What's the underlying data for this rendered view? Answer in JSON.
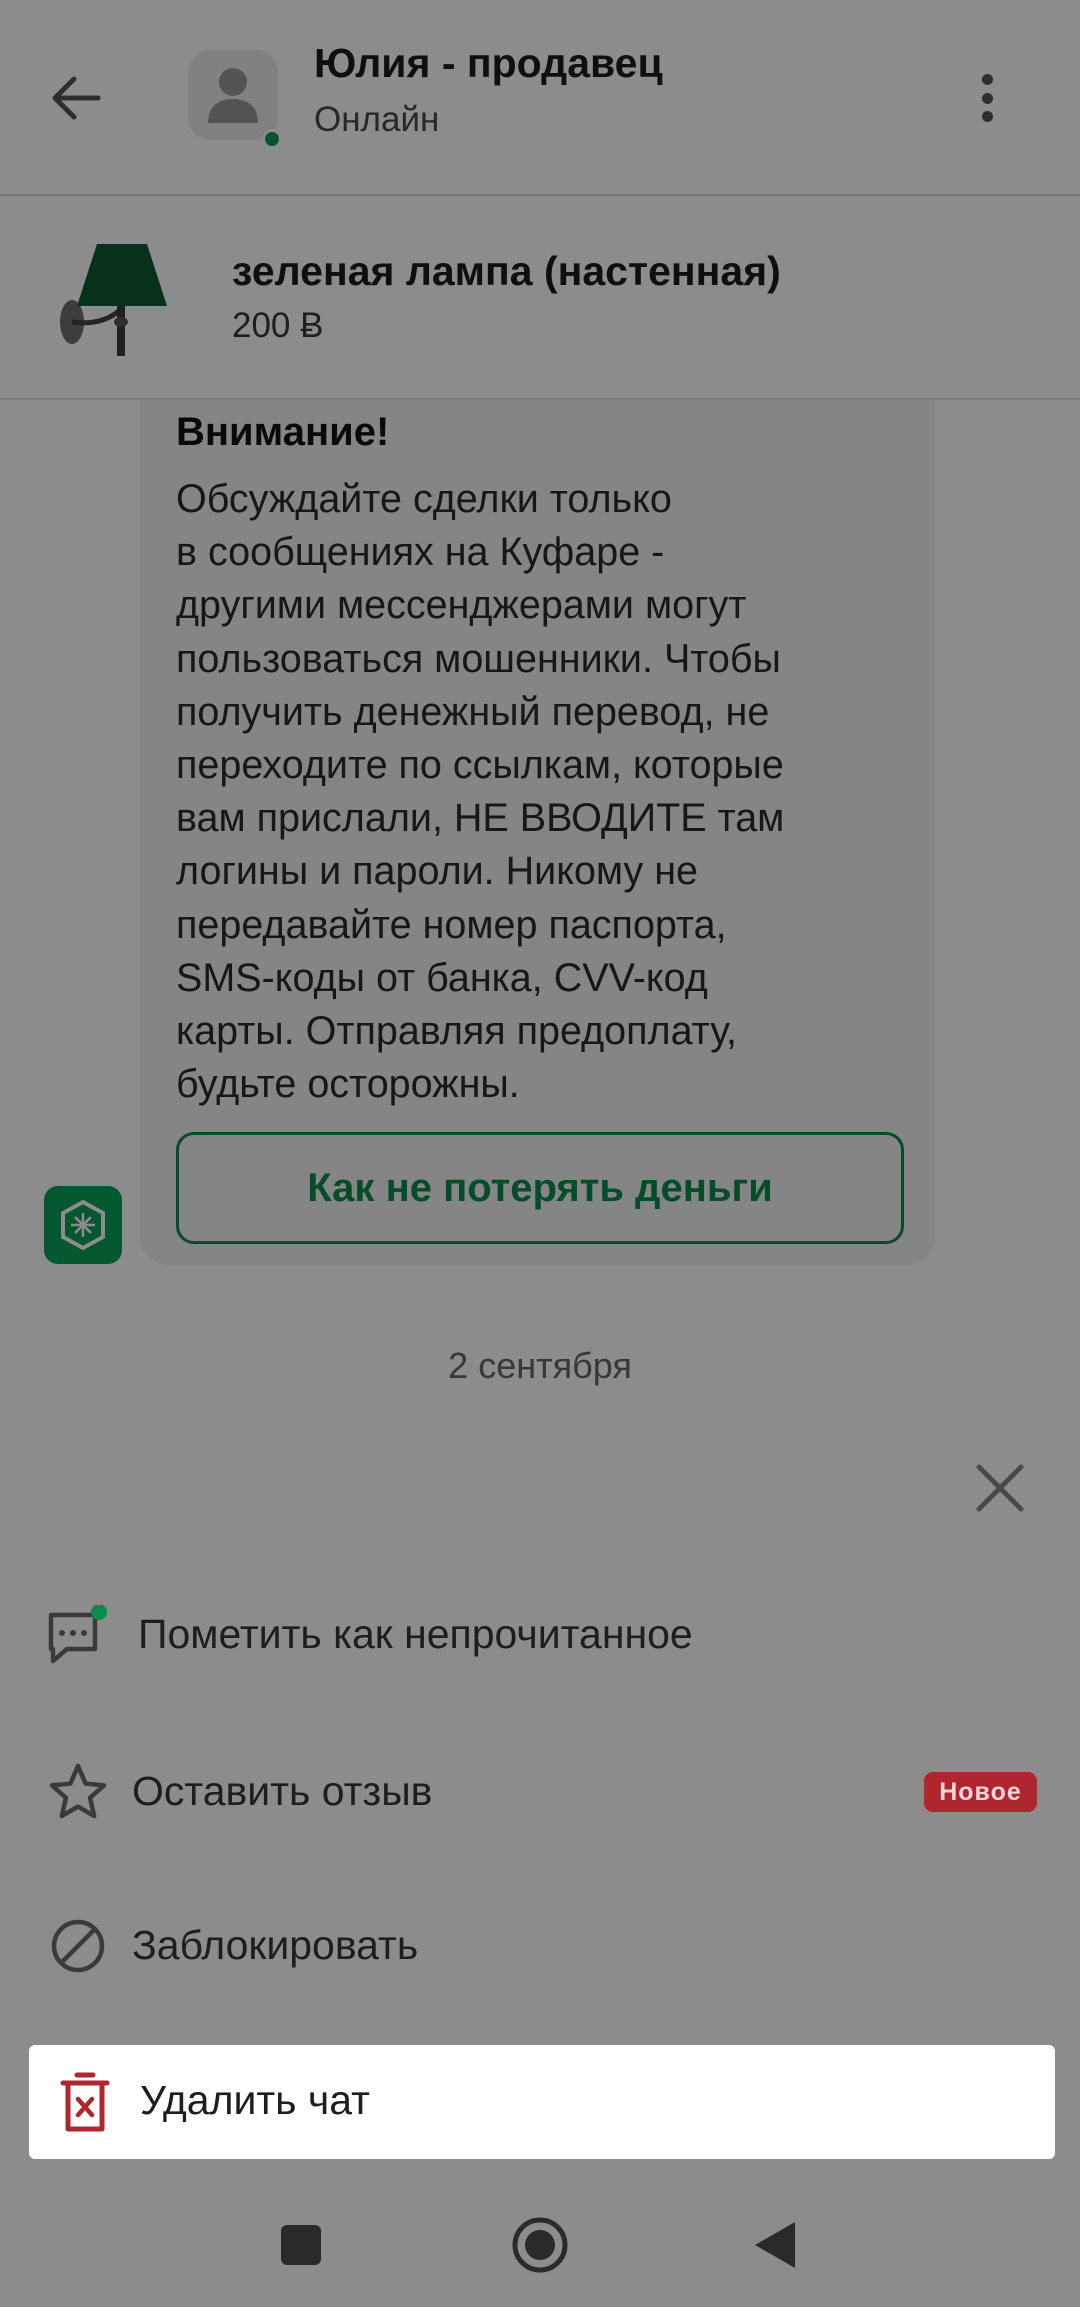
{
  "header": {
    "back_icon": "arrow-left-icon",
    "name": "Юлия - продавец",
    "status": "Онлайн",
    "more_icon": "more-vertical-icon"
  },
  "product": {
    "title": "зеленая лампа (настенная)",
    "price": "200 Ƀ"
  },
  "warning": {
    "title": "Внимание!",
    "text": "Обсуждайте сделки только\nв сообщениях на Куфаре -\nдругими мессенджерами могут\nпользоваться мошенники. Чтобы\nполучить денежный перевод, не\nпереходите по ссылкам, которые\nвам прислали, НЕ ВВОДИТЕ там\nлогины и пароли. Никому не\nпередавайте номер паспорта,\nSMS-коды от банка, CVV-код\nкарты. Отправляя предоплату,\nбудьте осторожны.",
    "button_label": "Как не потерять деньги"
  },
  "date_separator": "2 сентября",
  "sheet": {
    "close_icon": "close-icon",
    "items": [
      {
        "label": "Пометить как непрочитанное",
        "icon": "unread-message-icon"
      },
      {
        "label": "Оставить отзыв",
        "icon": "star-icon",
        "badge": "Новое"
      },
      {
        "label": "Заблокировать",
        "icon": "block-icon"
      },
      {
        "label": "Удалить чат",
        "icon": "trash-icon"
      }
    ]
  },
  "colors": {
    "brand_green": "#0a9e58",
    "danger_red": "#b0262f",
    "dim_overlay": "rgba(0,0,0,0.45)"
  },
  "navbar": {
    "icons": [
      "square-recents-icon",
      "circle-home-icon",
      "triangle-back-icon"
    ]
  }
}
